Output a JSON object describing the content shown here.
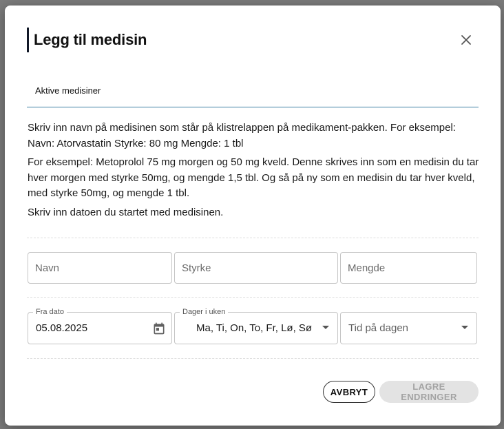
{
  "dialog": {
    "title": "Legg til medisin",
    "tab_label": "Aktive medisiner",
    "info": [
      "Skriv inn navn på medisinen som står på klistrelappen på medikament-pakken. For eksempel: Navn: Atorvastatin Styrke: 80 mg Mengde: 1 tbl",
      "For eksempel: Metoprolol 75 mg morgen og 50 mg kveld. Denne skrives inn som en medisin du tar hver morgen med styrke 50mg, og mengde 1,5 tbl. Og så på ny som en medisin du tar hver kveld, med styrke 50mg, og mengde 1 tbl.",
      "Skriv inn datoen du startet med medisinen."
    ]
  },
  "form": {
    "name_placeholder": "Navn",
    "strength_placeholder": "Styrke",
    "amount_placeholder": "Mengde",
    "from_date_label": "Fra dato",
    "from_date_value": "05.08.2025",
    "days_label": "Dager i uken",
    "days_value": "Ma, Ti, On, To, Fr, Lø, Sø",
    "time_placeholder": "Tid på dagen"
  },
  "actions": {
    "cancel": "AVBRYT",
    "save": "LAGRE ENDRINGER"
  },
  "icons": {
    "close": "close-icon",
    "calendar": "calendar-icon",
    "dropdown": "chevron-down-icon"
  },
  "colors": {
    "tab_underline": "#3a7ea1",
    "title_bar": "#111827",
    "save_disabled_bg": "#e3e3e3"
  }
}
